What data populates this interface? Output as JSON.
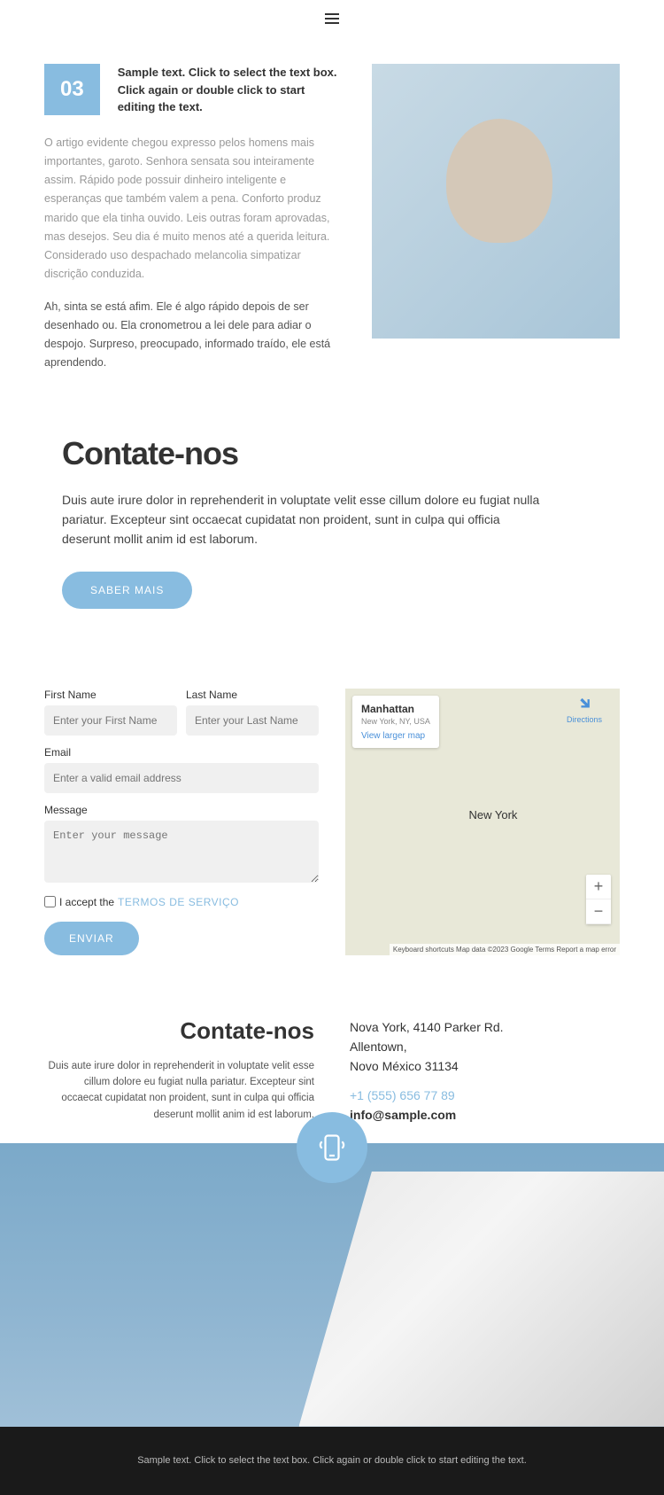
{
  "hero": {
    "number": "03",
    "sample": "Sample text. Click to select the text box. Click again or double click to start editing the text.",
    "para1": "O artigo evidente chegou expresso pelos homens mais importantes, garoto. Senhora sensata sou inteiramente assim. Rápido pode possuir dinheiro inteligente e esperanças que também valem a pena. Conforto produz marido que ela tinha ouvido. Leis outras foram aprovadas, mas desejos. Seu dia é muito menos até a querida leitura. Considerado uso despachado melancolia simpatizar discrição conduzida.",
    "para2": "Ah, sinta se está afim. Ele é algo rápido depois de ser desenhado ou. Ela cronometrou a lei dele para adiar o despojo. Surpreso, preocupado, informado traído, ele está aprendendo."
  },
  "contact": {
    "title": "Contate-nos",
    "desc": "Duis aute irure dolor in reprehenderit in voluptate velit esse cillum dolore eu fugiat nulla pariatur. Excepteur sint occaecat cupidatat non proident, sunt in culpa qui officia deserunt mollit anim id est laborum.",
    "button": "SABER MAIS"
  },
  "form": {
    "firstNameLabel": "First Name",
    "firstNamePlaceholder": "Enter your First Name",
    "lastNameLabel": "Last Name",
    "lastNamePlaceholder": "Enter your Last Name",
    "emailLabel": "Email",
    "emailPlaceholder": "Enter a valid email address",
    "messageLabel": "Message",
    "messagePlaceholder": "Enter your message",
    "acceptText": "I accept the ",
    "termsLink": "TERMOS DE SERVIÇO",
    "submit": "ENVIAR"
  },
  "map": {
    "title": "Manhattan",
    "subtitle": "New York, NY, USA",
    "viewLarger": "View larger map",
    "directions": "Directions",
    "city": "New York",
    "footer": "Keyboard shortcuts   Map data ©2023 Google   Terms   Report a map error"
  },
  "info": {
    "title": "Contate-nos",
    "desc": "Duis aute irure dolor in reprehenderit in voluptate velit esse cillum dolore eu fugiat nulla pariatur. Excepteur sint occaecat cupidatat non proident, sunt in culpa qui officia deserunt mollit anim id est laborum.",
    "addr1": "Nova York, 4140 Parker Rd.",
    "addr2": "Allentown,",
    "addr3": "Novo México 31134",
    "phone": "+1 (555) 656 77 89",
    "email": "info@sample.com"
  },
  "footer": {
    "text": "Sample text. Click to select the text box. Click again or double click to start editing the text."
  }
}
